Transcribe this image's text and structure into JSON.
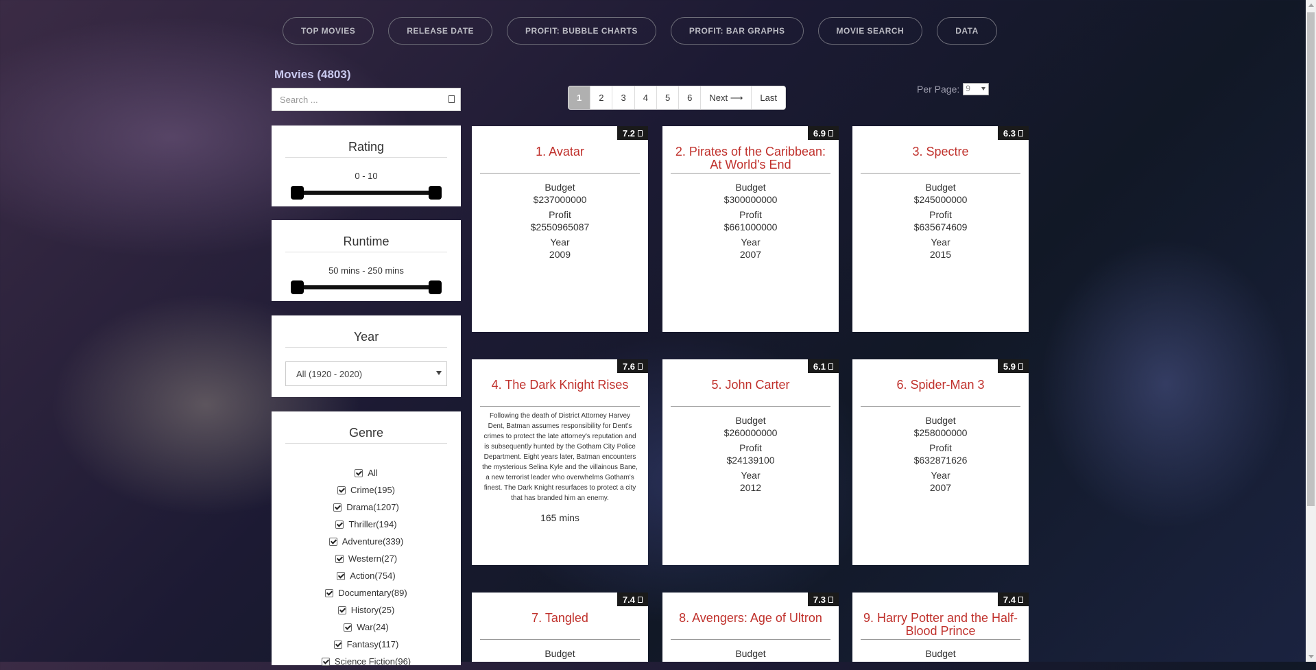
{
  "nav": [
    "TOP MOVIES",
    "RELEASE DATE",
    "PROFIT: BUBBLE CHARTS",
    "PROFIT: BAR GRAPHS",
    "MOVIE SEARCH",
    "DATA"
  ],
  "movies_count": "Movies (4803)",
  "search": {
    "placeholder": "Search ..."
  },
  "filters": {
    "rating": {
      "title": "Rating",
      "range": "0 - 10"
    },
    "runtime": {
      "title": "Runtime",
      "range": "50 mins - 250 mins"
    },
    "year": {
      "title": "Year",
      "selected": "All (1920 - 2020)"
    },
    "genre": {
      "title": "Genre"
    }
  },
  "genres": [
    "All",
    "Crime(195)",
    "Drama(1207)",
    "Thriller(194)",
    "Adventure(339)",
    "Western(27)",
    "Action(754)",
    "Documentary(89)",
    "History(25)",
    "War(24)",
    "Fantasy(117)",
    "Science Fiction(96)"
  ],
  "pagination": {
    "pages": [
      "1",
      "2",
      "3",
      "4",
      "5",
      "6"
    ],
    "next": "Next ⟶",
    "last": "Last",
    "current": "1"
  },
  "per_page": {
    "label": "Per Page:",
    "value": "9"
  },
  "labels": {
    "budget": "Budget",
    "profit": "Profit",
    "year": "Year"
  },
  "movies": [
    {
      "title": "1. Avatar",
      "rating": "7.2",
      "budget": "$237000000",
      "profit": "$2550965087",
      "year": "2009"
    },
    {
      "title": "2. Pirates of the Caribbean: At World's End",
      "rating": "6.9",
      "budget": "$300000000",
      "profit": "$661000000",
      "year": "2007"
    },
    {
      "title": "3. Spectre",
      "rating": "6.3",
      "budget": "$245000000",
      "profit": "$635674609",
      "year": "2015"
    },
    {
      "title": "4. The Dark Knight Rises",
      "rating": "7.6",
      "overview": "Following the death of District Attorney Harvey Dent, Batman assumes responsibility for Dent's crimes to protect the late attorney's reputation and is subsequently hunted by the Gotham City Police Department. Eight years later, Batman encounters the mysterious Selina Kyle and the villainous Bane, a new terrorist leader who overwhelms Gotham's finest. The Dark Knight resurfaces to protect a city that has branded him an enemy.",
      "runtime": "165 mins"
    },
    {
      "title": "5. John Carter",
      "rating": "6.1",
      "budget": "$260000000",
      "profit": "$24139100",
      "year": "2012"
    },
    {
      "title": "6. Spider-Man 3",
      "rating": "5.9",
      "budget": "$258000000",
      "profit": "$632871626",
      "year": "2007"
    },
    {
      "title": "7. Tangled",
      "rating": "7.4"
    },
    {
      "title": "8. Avengers: Age of Ultron",
      "rating": "7.3"
    },
    {
      "title": "9. Harry Potter and the Half-Blood Prince",
      "rating": "7.4"
    }
  ]
}
